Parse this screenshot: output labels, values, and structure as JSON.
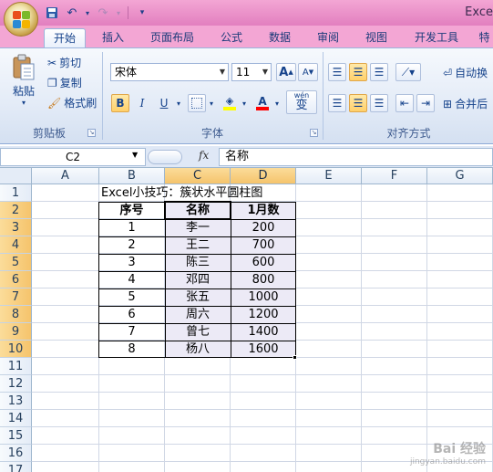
{
  "app": {
    "title": "Exce"
  },
  "colors": {
    "titlebar": "#e27fbf",
    "ribbon": "#e3ebf7",
    "selection_header": "#f5c46c"
  },
  "ribbon": {
    "tabs": [
      "开始",
      "插入",
      "页面布局",
      "公式",
      "数据",
      "审阅",
      "视图",
      "开发工具",
      "特"
    ],
    "active_tab": "开始",
    "clipboard": {
      "paste": "粘贴",
      "cut": "剪切",
      "copy": "复制",
      "format_painter": "格式刷",
      "group_label": "剪贴板"
    },
    "font": {
      "name": "宋体",
      "size": "11",
      "grow": "A",
      "shrink": "A",
      "bold": "B",
      "italic": "I",
      "underline": "U",
      "font_color": "A",
      "phonetic": "wén",
      "phonetic_char": "变",
      "group_label": "字体"
    },
    "alignment": {
      "wrap": "自动换",
      "merge": "合并后",
      "group_label": "对齐方式"
    }
  },
  "formula_bar": {
    "name_box": "C2",
    "fx_label": "fx",
    "value": "名称"
  },
  "sheet": {
    "columns": [
      "A",
      "B",
      "C",
      "D",
      "E",
      "F",
      "G"
    ],
    "rows": [
      "1",
      "2",
      "3",
      "4",
      "5",
      "6",
      "7",
      "8",
      "9",
      "10",
      "11",
      "12",
      "13",
      "14",
      "15",
      "16",
      "17"
    ],
    "title_cell": "Excel小技巧：簇状水平圆柱图",
    "table_headers": [
      "序号",
      "名称",
      "1月数"
    ],
    "table_rows": [
      [
        "1",
        "李一",
        "200"
      ],
      [
        "2",
        "王二",
        "700"
      ],
      [
        "3",
        "陈三",
        "600"
      ],
      [
        "4",
        "邓四",
        "800"
      ],
      [
        "5",
        "张五",
        "1000"
      ],
      [
        "6",
        "周六",
        "1200"
      ],
      [
        "7",
        "曾七",
        "1400"
      ],
      [
        "8",
        "杨八",
        "1600"
      ]
    ]
  },
  "watermark": {
    "main": "Bai 经验",
    "sub": "jingyan.baidu.com"
  }
}
